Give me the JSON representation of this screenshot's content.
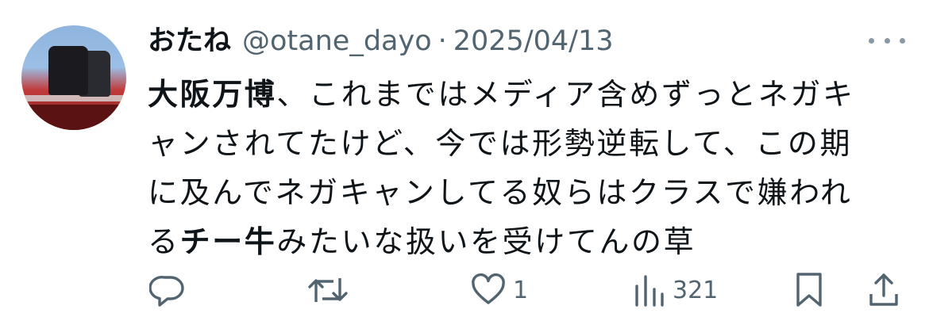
{
  "author": {
    "display_name": "おたね",
    "handle": "@otane_dayo",
    "separator": "·",
    "date": "2025/04/13"
  },
  "body": {
    "line1": {
      "bold": "大阪万博",
      "rest": "、これまではメディア含めずっとネガキ"
    },
    "line2": "ャンされてたけど、今では形勢逆転して、この期",
    "line3": "に及んでネガキャンしてる奴らはクラスで嫌われ",
    "line4": {
      "pre": "る",
      "bold": "チー牛",
      "rest": "みたいな扱いを受けてんの草"
    }
  },
  "actions": {
    "like_count": "1",
    "view_count": "321"
  },
  "icons": {
    "reply": "reply-icon",
    "retweet": "retweet-icon",
    "like": "heart-icon",
    "views": "views-bar-icon",
    "bookmark": "bookmark-icon",
    "share": "share-icon",
    "more": "more-icon"
  },
  "colors": {
    "text": "#0f1419",
    "secondary": "#536471",
    "more_dots": "#8b98a5"
  }
}
